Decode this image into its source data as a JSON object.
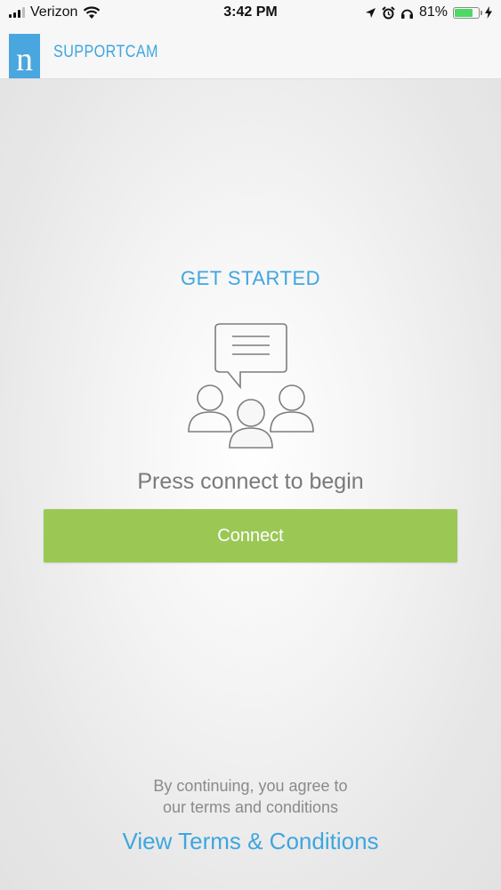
{
  "status_bar": {
    "carrier": "Verizon",
    "time": "3:42 PM",
    "battery": "81%",
    "battery_level": 0.81
  },
  "header": {
    "logo_letter": "n",
    "title": "SUPPORTCAM"
  },
  "main": {
    "heading": "GET STARTED",
    "prompt": "Press connect to begin",
    "connect_label": "Connect"
  },
  "footer": {
    "terms_line1": "By continuing, you agree to",
    "terms_line2": "our terms and conditions",
    "terms_link": "View Terms & Conditions"
  },
  "colors": {
    "accent": "#3ea6df",
    "button": "#9bc855",
    "battery": "#4cd964"
  },
  "icons": [
    "signal-icon",
    "wifi-icon",
    "location-arrow-icon",
    "alarm-icon",
    "headphones-icon",
    "battery-icon",
    "charging-bolt-icon",
    "group-chat-icon"
  ]
}
